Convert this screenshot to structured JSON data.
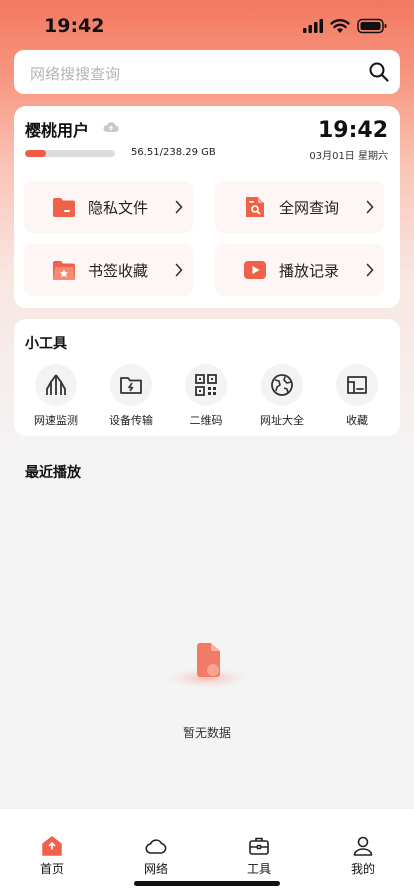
{
  "status_bar": {
    "time": "19:42"
  },
  "search": {
    "placeholder": "网络搜搜查询"
  },
  "user_card": {
    "username": "樱桃用户",
    "storage_text": "56.51/238.29 GB",
    "storage_fraction": 0.237,
    "clock": "19:42",
    "date": "03月01日 星期六"
  },
  "quick_actions": [
    {
      "label": "隐私文件",
      "icon": "folder-icon"
    },
    {
      "label": "全网查询",
      "icon": "search-document-icon"
    },
    {
      "label": "书签收藏",
      "icon": "star-folder-icon"
    },
    {
      "label": "播放记录",
      "icon": "video-play-icon"
    }
  ],
  "tools": {
    "title": "小工具",
    "items": [
      {
        "label": "网速监测",
        "icon": "speed-test-icon"
      },
      {
        "label": "设备传输",
        "icon": "device-transfer-icon"
      },
      {
        "label": "二维码",
        "icon": "qr-code-icon"
      },
      {
        "label": "网址大全",
        "icon": "globe-icon"
      },
      {
        "label": "收藏",
        "icon": "bookmark-folder-icon"
      }
    ]
  },
  "recent": {
    "title": "最近播放",
    "empty_text": "暂无数据"
  },
  "tab_bar": [
    {
      "label": "首页",
      "icon": "home-icon",
      "active": true
    },
    {
      "label": "网络",
      "icon": "cloud-icon"
    },
    {
      "label": "工具",
      "icon": "toolbox-icon"
    },
    {
      "label": "我的",
      "icon": "user-icon"
    }
  ],
  "colors": {
    "accent": "#ef5d45",
    "gradient_top": "#f3785f",
    "background": "#f4f4f5"
  }
}
